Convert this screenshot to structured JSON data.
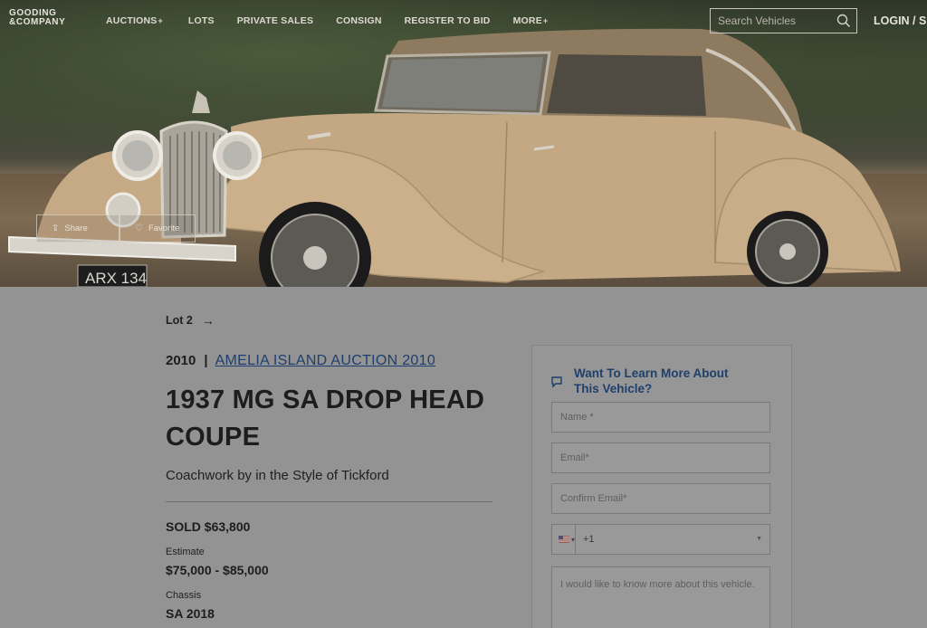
{
  "brand": {
    "logo_line1": "GOODING",
    "logo_line2": "&COMPANY"
  },
  "nav": {
    "items": [
      {
        "label": "AUCTIONS",
        "has_plus": true
      },
      {
        "label": "LOTS",
        "has_plus": false
      },
      {
        "label": "PRIVATE SALES",
        "has_plus": false
      },
      {
        "label": "CONSIGN",
        "has_plus": false
      },
      {
        "label": "REGISTER TO BID",
        "has_plus": false
      },
      {
        "label": "MORE",
        "has_plus": true
      }
    ],
    "plus_symbol": "+",
    "search_placeholder": "Search Vehicles",
    "login_label": "LOGIN / SIG"
  },
  "hero": {
    "share_label": "Share",
    "favorite_label": "Favorite",
    "license_plate": "ARX 134"
  },
  "lot": {
    "lot_label": "Lot 2",
    "year": "2010",
    "separator": "|",
    "auction_name": "AMELIA ISLAND AUCTION 2010",
    "title": "1937 MG SA DROP HEAD COUPE",
    "coachwork": "Coachwork by in the Style of Tickford",
    "sold": "SOLD $63,800",
    "estimate_label": "Estimate",
    "estimate_value": "$75,000 - $85,000",
    "chassis_label": "Chassis",
    "chassis_value": "SA 2018"
  },
  "inquiry_form": {
    "title": "Want To Learn More About This Vehicle?",
    "name_placeholder": "Name *",
    "email_placeholder": "Email*",
    "confirm_email_placeholder": "Confirm Email*",
    "phone_code": "+1",
    "message_placeholder": "I would like to know more about this vehicle."
  },
  "colors": {
    "overlay_bg": "#939393",
    "link_blue": "#1e3f6e",
    "car_body": "#c9ad87"
  }
}
